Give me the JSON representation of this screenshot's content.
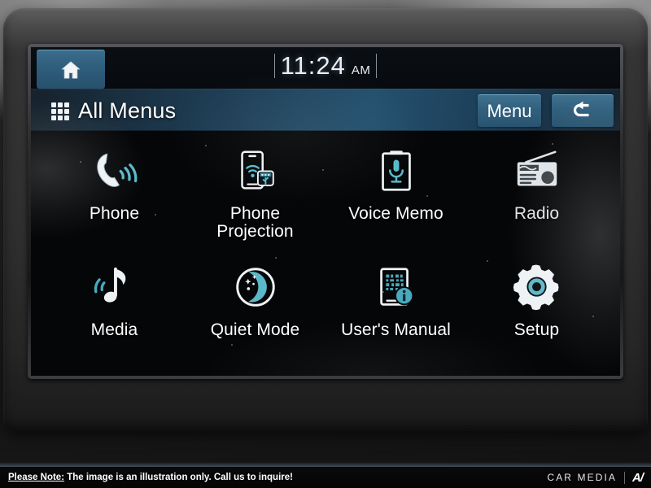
{
  "statusbar": {
    "home_icon": "home-icon",
    "time": "11:24",
    "meridiem": "AM"
  },
  "titlebar": {
    "grid_icon": "grid-icon",
    "title": "All Menus",
    "menu_button": "Menu",
    "back_icon": "back-arrow-icon"
  },
  "apps": [
    {
      "label": "Phone",
      "icon": "phone-handset-icon"
    },
    {
      "label": "Phone\nProjection",
      "icon": "phone-projection-icon"
    },
    {
      "label": "Voice Memo",
      "icon": "voice-memo-icon"
    },
    {
      "label": "Radio",
      "icon": "radio-icon"
    },
    {
      "label": "Media",
      "icon": "music-note-icon"
    },
    {
      "label": "Quiet Mode",
      "icon": "moon-icon"
    },
    {
      "label": "User's Manual",
      "icon": "users-manual-icon"
    },
    {
      "label": "Setup",
      "icon": "gear-icon"
    }
  ],
  "disclaimer": {
    "prefix": "Please Note:",
    "text": " The image is an illustration only. Call us to inquire!"
  },
  "brand": {
    "name": "CAR MEDIA",
    "mark": "A/"
  },
  "colors": {
    "accent_teal": "#58b9c9",
    "icon_white": "#e9edf1",
    "titlebar_blue": "#23506e",
    "button_blue": "#31607e",
    "screen_black": "#050608"
  }
}
